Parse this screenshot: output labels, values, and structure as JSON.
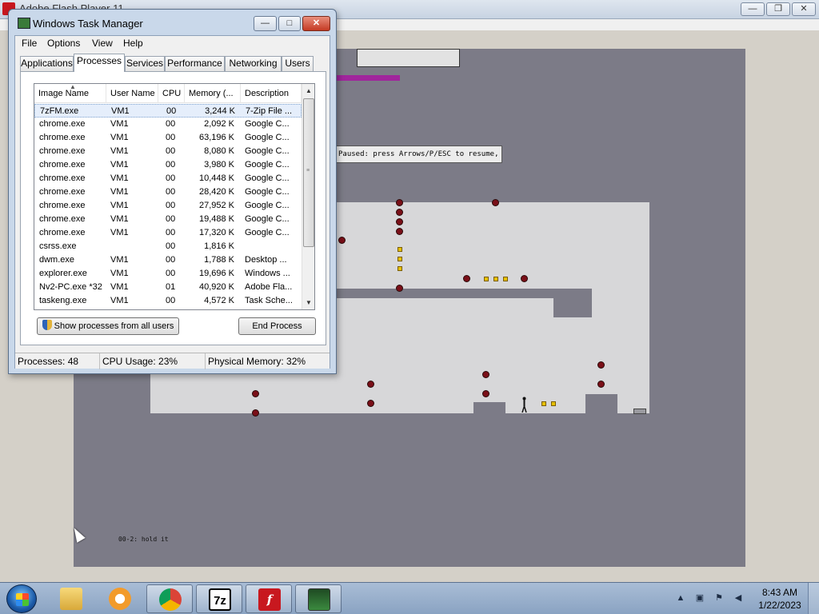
{
  "flash_window": {
    "title": "Adobe Flash Player 11",
    "controls": {
      "minimize": "—",
      "restore": "❐",
      "close": "✕"
    }
  },
  "game": {
    "pause_message": "Paused: press Arrows/P/ESC to resume, Q to quit.",
    "level_name": "00-2: hold it"
  },
  "task_manager": {
    "title": "Windows Task Manager",
    "controls": {
      "minimize": "—",
      "maximize": "□",
      "close": "✕"
    },
    "menu": [
      "File",
      "Options",
      "View",
      "Help"
    ],
    "tabs": [
      "Applications",
      "Processes",
      "Services",
      "Performance",
      "Networking",
      "Users"
    ],
    "active_tab": "Processes",
    "columns": [
      "Image Name",
      "User Name",
      "CPU",
      "Memory (...",
      "Description"
    ],
    "processes": [
      {
        "image": "7zFM.exe",
        "user": "VM1",
        "cpu": "00",
        "mem": "3,244 K",
        "desc": "7-Zip File ...",
        "selected": true
      },
      {
        "image": "chrome.exe",
        "user": "VM1",
        "cpu": "00",
        "mem": "2,092 K",
        "desc": "Google C..."
      },
      {
        "image": "chrome.exe",
        "user": "VM1",
        "cpu": "00",
        "mem": "63,196 K",
        "desc": "Google C..."
      },
      {
        "image": "chrome.exe",
        "user": "VM1",
        "cpu": "00",
        "mem": "8,080 K",
        "desc": "Google C..."
      },
      {
        "image": "chrome.exe",
        "user": "VM1",
        "cpu": "00",
        "mem": "3,980 K",
        "desc": "Google C..."
      },
      {
        "image": "chrome.exe",
        "user": "VM1",
        "cpu": "00",
        "mem": "10,448 K",
        "desc": "Google C..."
      },
      {
        "image": "chrome.exe",
        "user": "VM1",
        "cpu": "00",
        "mem": "28,420 K",
        "desc": "Google C..."
      },
      {
        "image": "chrome.exe",
        "user": "VM1",
        "cpu": "00",
        "mem": "27,952 K",
        "desc": "Google C..."
      },
      {
        "image": "chrome.exe",
        "user": "VM1",
        "cpu": "00",
        "mem": "19,488 K",
        "desc": "Google C..."
      },
      {
        "image": "chrome.exe",
        "user": "VM1",
        "cpu": "00",
        "mem": "17,320 K",
        "desc": "Google C..."
      },
      {
        "image": "csrss.exe",
        "user": "",
        "cpu": "00",
        "mem": "1,816 K",
        "desc": ""
      },
      {
        "image": "dwm.exe",
        "user": "VM1",
        "cpu": "00",
        "mem": "1,788 K",
        "desc": "Desktop ..."
      },
      {
        "image": "explorer.exe",
        "user": "VM1",
        "cpu": "00",
        "mem": "19,696 K",
        "desc": "Windows ..."
      },
      {
        "image": "Nv2-PC.exe *32",
        "user": "VM1",
        "cpu": "01",
        "mem": "40,920 K",
        "desc": "Adobe Fla..."
      },
      {
        "image": "taskeng.exe",
        "user": "VM1",
        "cpu": "00",
        "mem": "4,572 K",
        "desc": "Task Sche..."
      }
    ],
    "show_all_button": "Show processes from all users",
    "end_process_button": "End Process",
    "status": {
      "processes": "Processes: 48",
      "cpu": "CPU Usage: 23%",
      "memory": "Physical Memory: 32%"
    }
  },
  "taskbar": {
    "start": "start-orb",
    "items": [
      {
        "name": "explorer",
        "icon": "folder-icon"
      },
      {
        "name": "media-player",
        "icon": "media-player-icon"
      },
      {
        "name": "chrome",
        "icon": "chrome-icon"
      },
      {
        "name": "7zip",
        "icon": "7zip-icon",
        "label": "7z"
      },
      {
        "name": "flash",
        "icon": "flash-icon",
        "label": "f"
      },
      {
        "name": "task-manager",
        "icon": "task-manager-icon"
      }
    ],
    "clock": {
      "time": "8:43 AM",
      "date": "1/22/2023"
    },
    "tray": {
      "show_hidden": "▲"
    }
  },
  "colors": {
    "game_bg": "#7c7b87",
    "level_fill": "#d7d7d9",
    "mine": "#7a0f18",
    "gold": "#e6c000",
    "hud_bar": "#a0259c"
  }
}
